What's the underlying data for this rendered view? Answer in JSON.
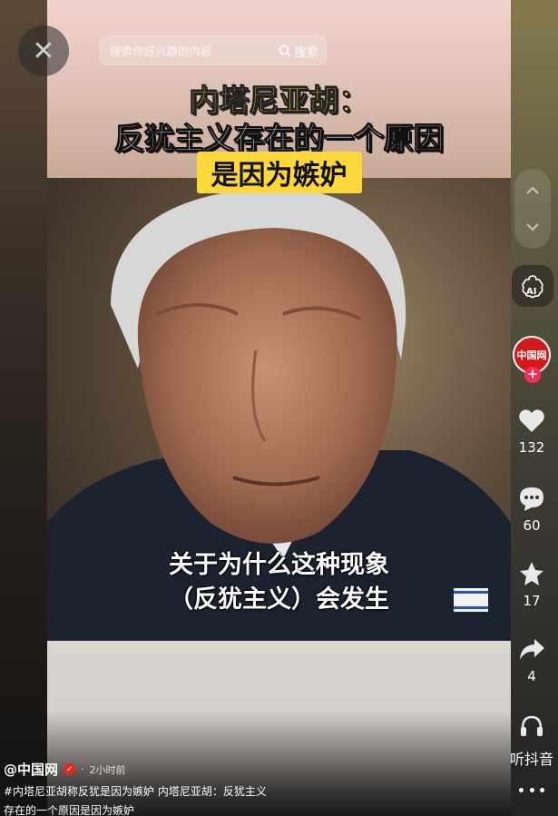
{
  "search": {
    "placeholder": "搜索你感兴趣的内容",
    "button_label": "搜索"
  },
  "video": {
    "title_line1": "内塔尼亚胡：",
    "title_line2": "反犹主义存在的一个原因",
    "title_line3": "是因为嫉妒",
    "subtitle_line1": "关于为什么这种现象",
    "subtitle_line2": "（反犹主义）会发生"
  },
  "sidebar": {
    "ai_label": "AI",
    "avatar_text": "中国网",
    "likes": "132",
    "comments": "60",
    "favorites": "17",
    "shares": "4",
    "listen_label": "听抖音"
  },
  "post": {
    "author": "@中国网",
    "separator": "·",
    "time": "2小时前",
    "description": "#内塔尼亚胡称反犹是因为嫉妒 内塔尼亚胡：反犹主义存在的一个原因是因为嫉妒"
  },
  "colors": {
    "accent": "#fdd83a",
    "like": "#fe2c55",
    "brand_red": "#d31a1a"
  },
  "icons": [
    "close-icon",
    "search-icon",
    "chevron-up-icon",
    "chevron-down-icon",
    "ai-icon",
    "heart-icon",
    "comment-icon",
    "star-icon",
    "share-icon",
    "headphones-icon",
    "more-icon"
  ]
}
